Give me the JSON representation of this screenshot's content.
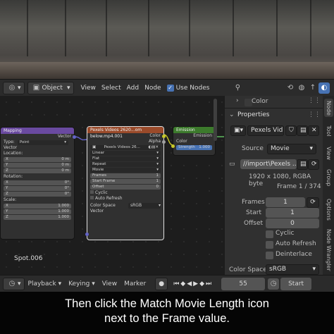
{
  "header": {
    "mode": "Object",
    "menus": [
      "View",
      "Select",
      "Add",
      "Node"
    ],
    "use_nodes_label": "Use Nodes",
    "use_nodes_checked": true
  },
  "nodes": {
    "mapping": {
      "title": "Mapping",
      "output": "Vector",
      "type_label": "Type:",
      "type_value": "Point",
      "input_vector": "Vector",
      "location_label": "Location:",
      "location": [
        {
          "axis": "X",
          "value": "0 m"
        },
        {
          "axis": "Y",
          "value": "0 m"
        },
        {
          "axis": "Z",
          "value": "0 m"
        }
      ],
      "rotation_label": "Rotation:",
      "rotation": [
        {
          "axis": "X",
          "value": "0°"
        },
        {
          "axis": "Y",
          "value": "0°"
        },
        {
          "axis": "Z",
          "value": "0°"
        }
      ],
      "scale_label": "Scale:",
      "scale": [
        {
          "axis": "X",
          "value": "1.000"
        },
        {
          "axis": "Y",
          "value": "1.000"
        },
        {
          "axis": "Z",
          "value": "1.000"
        }
      ]
    },
    "image": {
      "title": "Pexels Videos 2620...om below.mp4.001",
      "out_color": "Color",
      "out_alpha": "Alpha",
      "file": "Pexels Videos 26...",
      "interpolation": "Linear",
      "projection": "Flat",
      "extension": "Repeat",
      "source": "Movie",
      "frames_label": "Frames",
      "frames_value": "1",
      "start_label": "Start Frame",
      "start_value": "1",
      "offset_label": "Offset",
      "offset_value": "0",
      "cyclic_label": "Cyclic",
      "auto_refresh_label": "Auto Refresh",
      "colorspace_label": "Color Space",
      "colorspace_value": "sRGB",
      "in_vector": "Vector"
    },
    "emission": {
      "title": "Emission",
      "output": "Emission",
      "in_color": "Color",
      "strength_label": "Strength",
      "strength_value": "1.000"
    },
    "object_label": "Spot.006"
  },
  "panel": {
    "color_label": "Color",
    "properties_label": "Properties",
    "image_name": "Pexels Vid...",
    "source_label": "Source",
    "source_value": "Movie",
    "filepath": "//import\\Pexels ...",
    "resolution": "1920 x 1080,  RGBA byte",
    "frame_info": "Frame 1 / 374",
    "frames_label": "Frames",
    "frames_value": "1",
    "start_label": "Start",
    "start_value": "1",
    "offset_label": "Offset",
    "offset_value": "0",
    "cyclic_label": "Cyclic",
    "auto_refresh_label": "Auto Refresh",
    "deinterlace_label": "Deinterlace",
    "colorspace_label": "Color Space",
    "colorspace_value": "sRGB"
  },
  "side_tabs": [
    "Node",
    "Tool",
    "View",
    "Group",
    "Options",
    "Node Wrangler"
  ],
  "timeline": {
    "menus": [
      "Playback",
      "Keying",
      "View",
      "Marker"
    ],
    "current_frame": "55",
    "start_label": "Start"
  },
  "caption": {
    "line1": "Then click the Match Movie Length icon",
    "line2": "next to the Frame value."
  },
  "colors": {
    "mapping_header": "#6a4aa0",
    "image_header": "#9a4a2a",
    "emission_header": "#3c7a2c",
    "accent_blue": "#4772b3"
  }
}
